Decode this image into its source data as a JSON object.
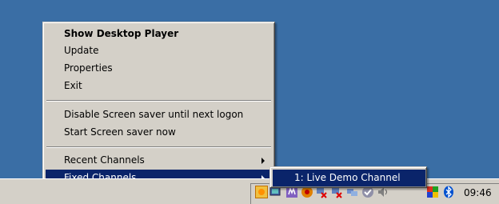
{
  "context_menu": {
    "items": [
      {
        "label": "Show Desktop Player",
        "bold": true
      },
      {
        "label": "Update"
      },
      {
        "label": "Properties"
      },
      {
        "label": "Exit"
      },
      {
        "label": "Disable Screen saver until next logon"
      },
      {
        "label": "Start Screen saver now"
      },
      {
        "label": "Recent Channels",
        "submenu": true
      },
      {
        "label": "Fixed Channels",
        "submenu": true,
        "selected": true
      }
    ]
  },
  "submenu": {
    "items": [
      {
        "label": "1: Live Demo Channel",
        "selected": true
      }
    ]
  },
  "taskbar": {
    "clock": "09:46",
    "tray_icons": [
      "sun-icon",
      "monitor-icon",
      "media-icon",
      "shield-icon",
      "network-error-icon",
      "network-error-icon-2",
      "network-icon",
      "check-icon",
      "speaker-icon",
      "security-flag-icon",
      "bluetooth-icon"
    ]
  },
  "colors": {
    "desktop": "#3a6ea5",
    "menu_bg": "#d4d0c8",
    "highlight": "#0a246a"
  }
}
